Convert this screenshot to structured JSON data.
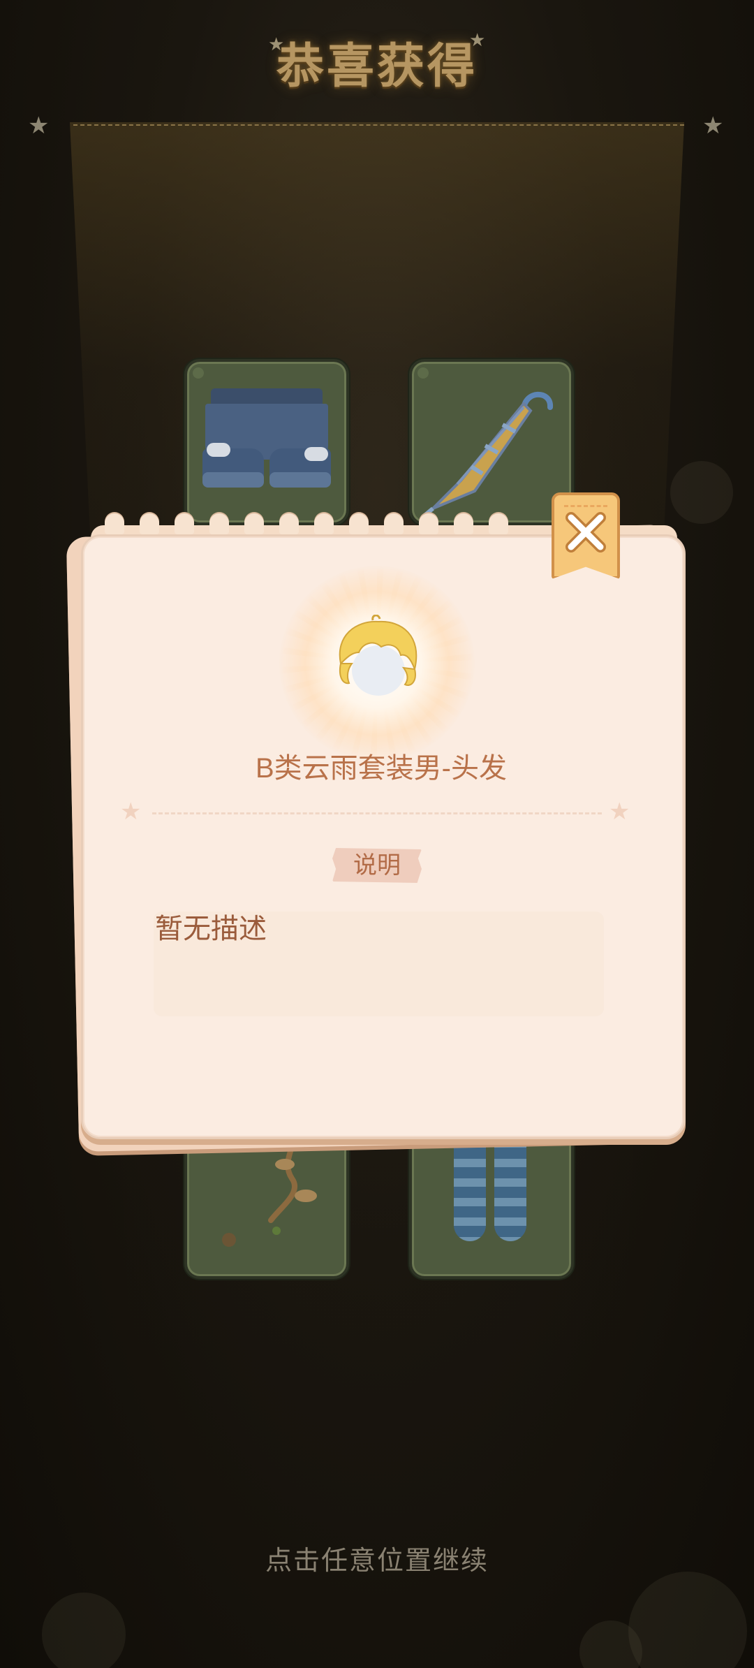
{
  "header": {
    "title": "恭喜获得"
  },
  "rewards": [
    {
      "name": "denim-shorts"
    },
    {
      "name": "umbrella"
    },
    {
      "name": "vine"
    },
    {
      "name": "striped-socks"
    }
  ],
  "dialog": {
    "item_name": "B类云雨套装男-头发",
    "section_label": "说明",
    "description": "暂无描述",
    "close_icon": "close-icon"
  },
  "footer": {
    "hint": "点击任意位置继续"
  },
  "colors": {
    "title": "#b69662",
    "dialog_bg": "#fbece1",
    "item_name": "#b9724a",
    "close_button": "#f6c77a"
  }
}
